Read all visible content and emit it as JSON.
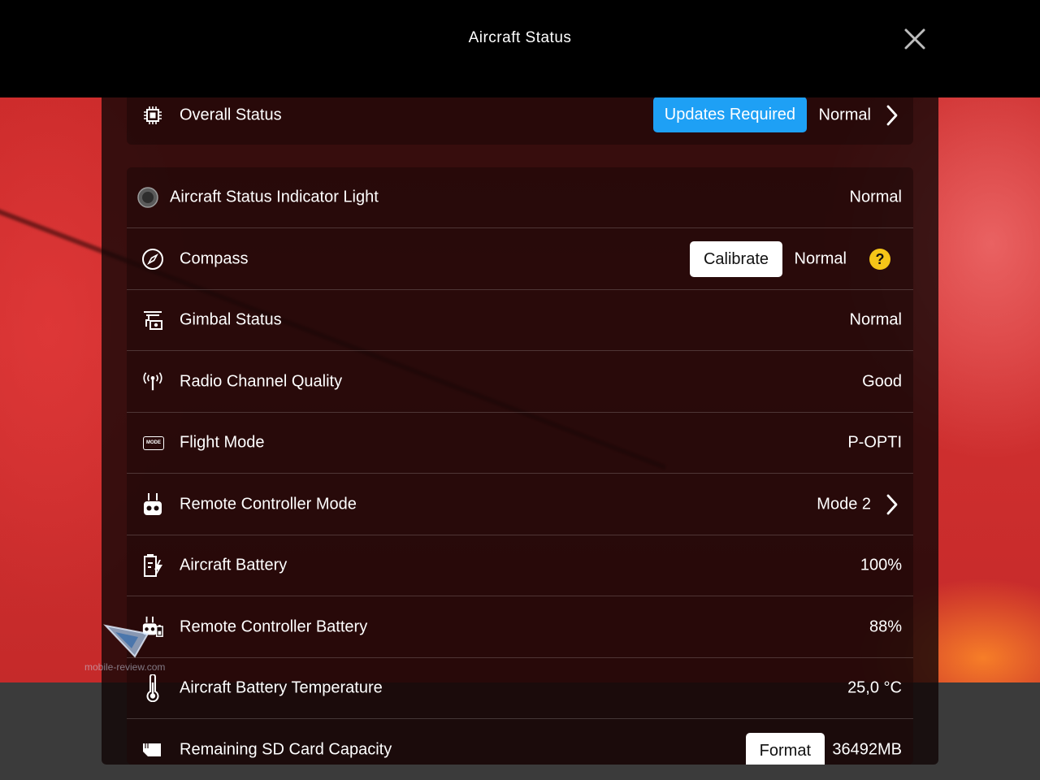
{
  "header": {
    "title": "Aircraft Status"
  },
  "overall": {
    "label": "Overall Status",
    "badge": "Updates Required",
    "value": "Normal",
    "badge_color": "#1ea0f5"
  },
  "rows": [
    {
      "label": "Aircraft Status Indicator Light",
      "value": "Normal",
      "icon": "indicator-light-icon"
    },
    {
      "label": "Compass",
      "button": "Calibrate",
      "value": "Normal",
      "help": "?",
      "icon": "compass-icon"
    },
    {
      "label": "Gimbal Status",
      "value": "Normal",
      "icon": "gimbal-icon"
    },
    {
      "label": "Radio Channel Quality",
      "value": "Good",
      "icon": "radio-signal-icon"
    },
    {
      "label": "Flight Mode",
      "value": "P-OPTI",
      "icon": "mode-icon",
      "icon_text": "MODE"
    },
    {
      "label": "Remote Controller Mode",
      "value": "Mode 2",
      "icon": "remote-controller-icon"
    },
    {
      "label": "Aircraft Battery",
      "value": "100%",
      "icon": "aircraft-battery-icon"
    },
    {
      "label": "Remote Controller Battery",
      "value": "88%",
      "icon": "rc-battery-icon"
    },
    {
      "label": "Aircraft Battery Temperature",
      "value": "25,0 °C",
      "icon": "thermometer-icon"
    },
    {
      "label": "Remaining SD Card Capacity",
      "button": "Format",
      "value": "36492MB",
      "icon": "sd-card-icon"
    }
  ],
  "watermark": {
    "text": "mobile-review.com"
  },
  "colors": {
    "help_yellow": "#f5c518",
    "header_bg": "#000000"
  }
}
